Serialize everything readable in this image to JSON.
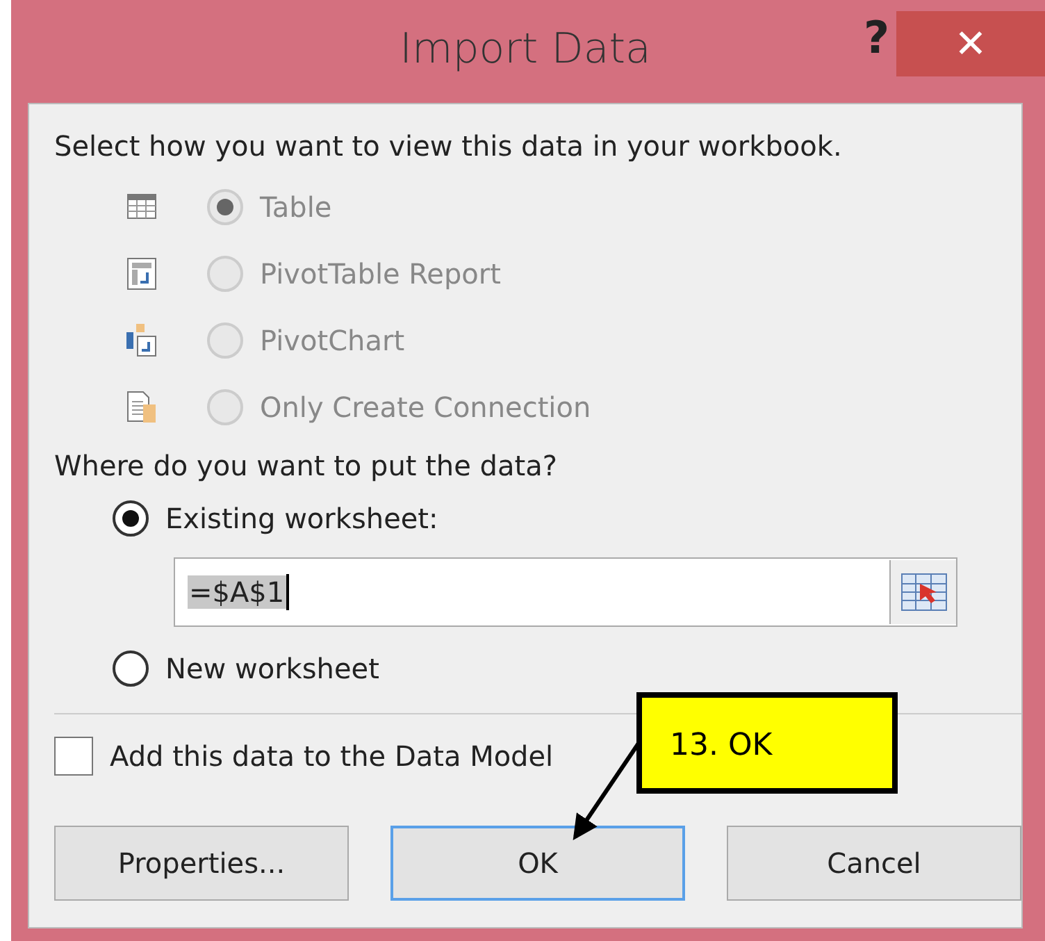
{
  "window": {
    "title": "Import Data",
    "help": "?",
    "close": "✕"
  },
  "view_prompt": "Select how you want to view this data in your workbook.",
  "view_options": [
    {
      "kind": "table",
      "label": "Table",
      "selected": true,
      "disabled": true
    },
    {
      "kind": "pivottable",
      "label": "PivotTable Report",
      "selected": false,
      "disabled": true
    },
    {
      "kind": "pivotchart",
      "label": "PivotChart",
      "selected": false,
      "disabled": true
    },
    {
      "kind": "connection",
      "label": "Only Create Connection",
      "selected": false,
      "disabled": true
    }
  ],
  "location_prompt": "Where do you want to put the data?",
  "location_options": [
    {
      "kind": "existing",
      "label": "Existing worksheet:",
      "selected": true
    },
    {
      "kind": "new",
      "label": "New worksheet",
      "selected": false
    }
  ],
  "range_field": {
    "value": "=$A$1"
  },
  "data_model": {
    "label": "Add this data to the Data Model",
    "checked": false
  },
  "buttons": [
    {
      "label": "Properties...",
      "focused": false
    },
    {
      "label": "OK",
      "focused": true
    },
    {
      "label": "Cancel",
      "focused": false
    }
  ],
  "callout": {
    "text": "13. OK"
  }
}
